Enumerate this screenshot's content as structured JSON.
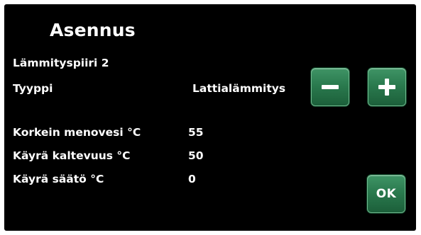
{
  "screen": {
    "title": "Asennus",
    "subtitle": "Lämmityspiiri 2",
    "type_label": "Tyyppi",
    "type_value": "Lattialämmitys",
    "settings": [
      {
        "label": "Korkein menovesi °C",
        "value": "55"
      },
      {
        "label": "Käyrä kaltevuus °C",
        "value": "50"
      },
      {
        "label": "Käyrä säätö °C",
        "value": "0"
      }
    ],
    "buttons": {
      "ok_label": "OK"
    }
  },
  "icons": {
    "minus": "minus-icon",
    "plus": "plus-icon"
  },
  "colors": {
    "background": "#000000",
    "button": "#2a7a4e",
    "text": "#ffffff"
  }
}
